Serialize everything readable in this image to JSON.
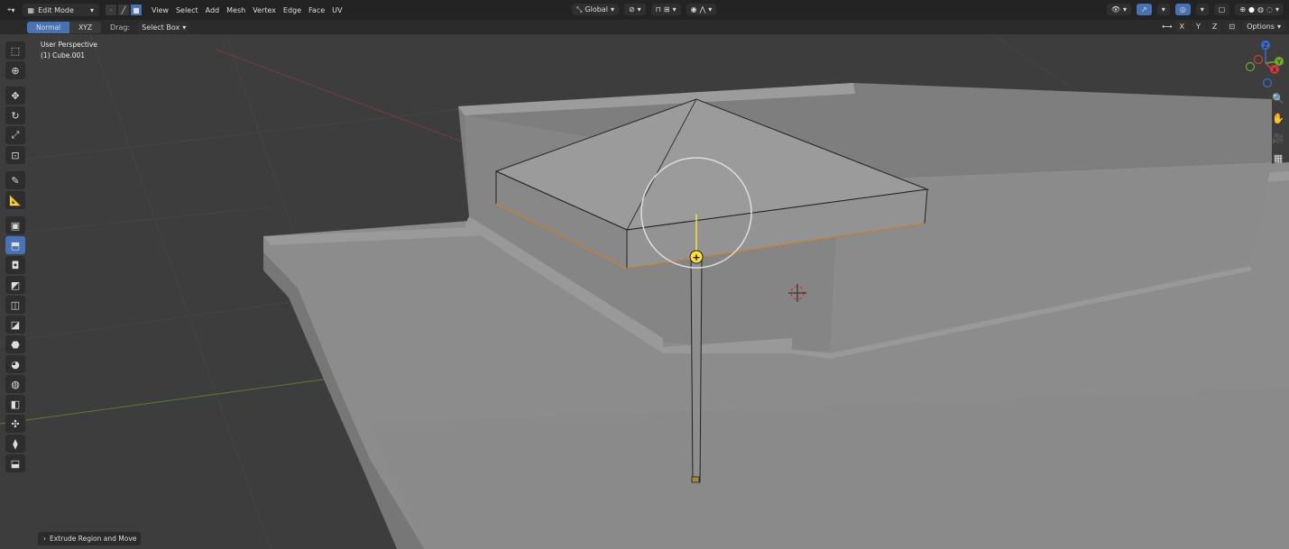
{
  "header": {
    "mode": "Edit Mode",
    "menus": [
      "View",
      "Select",
      "Add",
      "Mesh",
      "Vertex",
      "Edge",
      "Face",
      "UV"
    ],
    "transform_orientation": "Global",
    "accent": "#4772b3"
  },
  "toolbar": {
    "normal": "Normal",
    "xyz": "XYZ",
    "drag_label": "Drag:",
    "select_box": "Select Box",
    "axis_x": "X",
    "axis_y": "Y",
    "axis_z": "Z",
    "options": "Options"
  },
  "viewport": {
    "perspective": "User Perspective",
    "object": "(1) Cube.001",
    "gizmo_x": "X",
    "gizmo_y": "Y",
    "gizmo_z": "Z"
  },
  "operator_panel": {
    "label": "Extrude Region and Move"
  },
  "icons": [
    "editor-type-icon",
    "mode-icon",
    "vertex-select-icon",
    "edge-select-icon",
    "face-select-icon",
    "transform-orientation-icon",
    "pivot-icon",
    "snap-icon",
    "proportional-icon",
    "visibility-icon",
    "gizmo-icon",
    "overlay-icon",
    "xray-icon",
    "shading-icons",
    "select-box-icon",
    "cursor-icon",
    "move-icon",
    "rotate-icon",
    "scale-icon",
    "transform-icon",
    "annotate-icon",
    "measure-icon",
    "add-cube-icon",
    "extrude-icon",
    "inset-icon",
    "bevel-icon",
    "loop-cut-icon",
    "knife-icon",
    "poly-build-icon",
    "spin-icon",
    "smooth-icon",
    "edge-slide-icon",
    "shrink-fatten-icon",
    "shear-icon",
    "rip-icon",
    "zoom-icon",
    "pan-icon",
    "camera-icon",
    "grid-icon"
  ]
}
